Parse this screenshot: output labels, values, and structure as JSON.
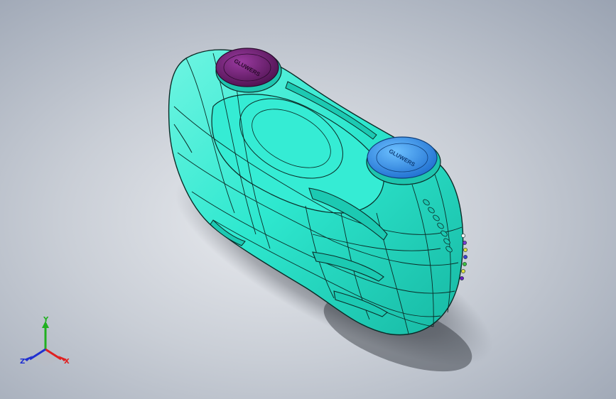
{
  "viewport": {
    "background_center": "#e9ebef",
    "background_edge": "#9aa3b2"
  },
  "model": {
    "body_color": "#2ee8cf",
    "body_shadow_color": "#14a896",
    "edge_color": "#0b2b27",
    "cap_rear_color": "#6a1d6e",
    "cap_front_color": "#2f8fe8",
    "cap_text": "GLUWERS"
  },
  "triad": {
    "x_label": "X",
    "y_label": "Y",
    "z_label": "Z",
    "x_color": "#e02020",
    "y_color": "#20b020",
    "z_color": "#2030d0"
  }
}
